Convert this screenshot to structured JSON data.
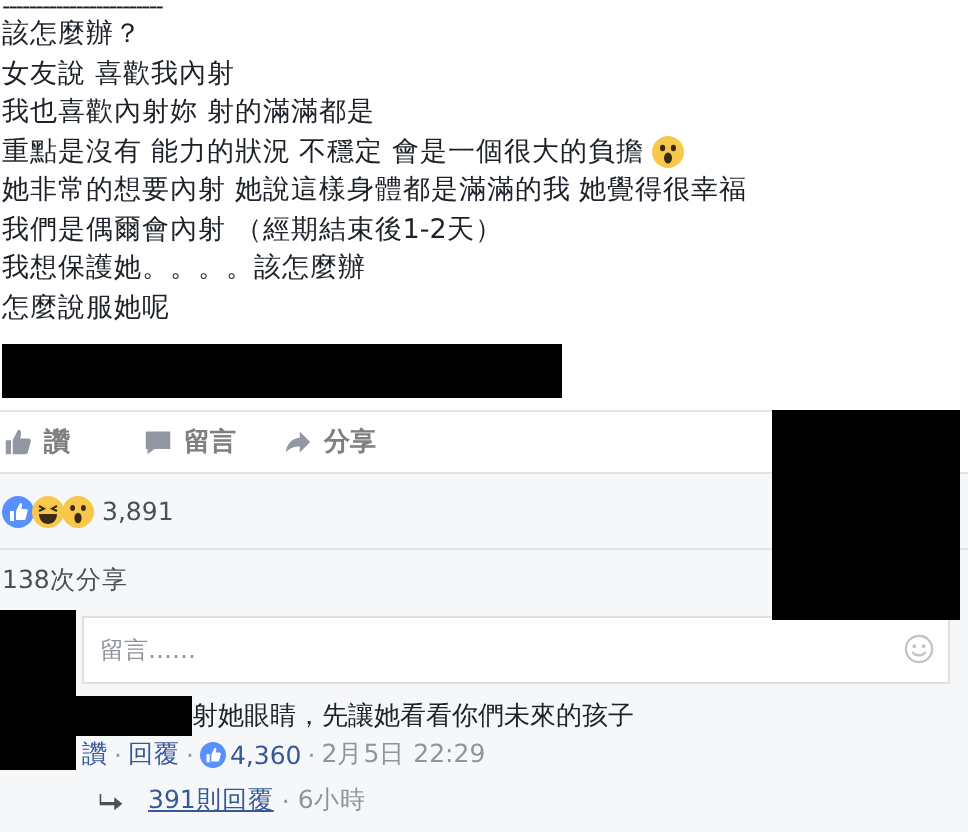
{
  "post": {
    "separator": "------------------------",
    "lines": [
      {
        "text": "該怎麼辦？"
      },
      {
        "text": "女友說 喜歡我內射"
      },
      {
        "text": "我也喜歡內射妳 射的滿滿都是"
      },
      {
        "text": "重點是沒有 能力的狀況 不穩定 會是一個很大的負擔",
        "kind": "emoji"
      },
      {
        "text": "她非常的想要內射 她說這樣身體都是滿滿的我 她覺得很幸福"
      },
      {
        "text": "我們是偶爾會內射 （經期結束後1-2天）"
      },
      {
        "text": "我想保護她。。。。該怎麼辦"
      },
      {
        "text": "怎麼說服她呢"
      }
    ]
  },
  "actions": [
    {
      "kind": "like",
      "label": "讚"
    },
    {
      "kind": "comment",
      "label": "留言"
    },
    {
      "kind": "share",
      "label": "分享"
    }
  ],
  "reactions": {
    "count": "3,891"
  },
  "shares": "138次分享",
  "comment_box": {
    "placeholder": "留言……"
  },
  "comment": {
    "text": "射她眼睛，先讓她看看你們未來的孩子",
    "like": "讚",
    "reply": "回覆",
    "likes": "4,360",
    "time": "2月5日 22:29",
    "separator": "·",
    "replies": "391則回覆",
    "replies_time": "6小時"
  }
}
